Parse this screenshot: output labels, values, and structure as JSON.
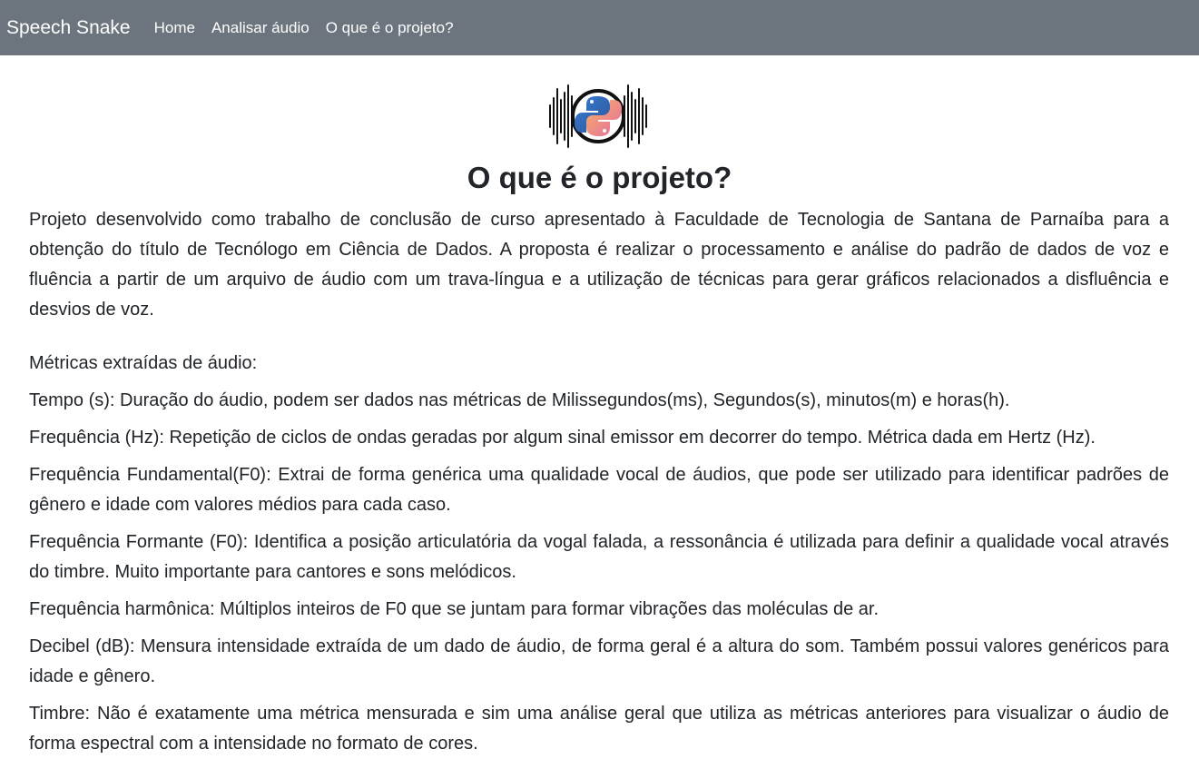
{
  "navbar": {
    "brand": "Speech Snake",
    "links": [
      "Home",
      "Analisar áudio",
      "O que é o projeto?"
    ],
    "background": "#6c757d"
  },
  "logo": {
    "icon": "python-soundwave-logo"
  },
  "main": {
    "title": "O que é o projeto?",
    "intro": "Projeto desenvolvido como trabalho de conclusão de curso apresentado à Faculdade de Tecnologia de Santana de Parnaíba para a obtenção do título de Tecnólogo em Ciência de Dados. A proposta é realizar o processamento e análise do padrão de dados de voz e fluência a partir de um arquivo de áudio com um trava-língua e a utilização de técnicas para gerar gráficos relacionados a disfluência e desvios de voz.",
    "metrics_heading": "Métricas extraídas de áudio:",
    "metrics": [
      "Tempo (s): Duração do áudio, podem ser dados nas métricas de Milissegundos(ms), Segundos(s), minutos(m) e horas(h).",
      "Frequência (Hz): Repetição de ciclos de ondas geradas por algum sinal emissor em decorrer do tempo. Métrica dada em Hertz (Hz).",
      "Frequência Fundamental(F0): Extrai de forma genérica uma qualidade vocal de áudios, que pode ser utilizado para identificar padrões de gênero e idade com valores médios para cada caso.",
      "Frequência Formante (F0): Identifica a posição articulatória da vogal falada, a ressonância é utilizada para definir a qualidade vocal através do timbre. Muito importante para cantores e sons melódicos.",
      "Frequência harmônica: Múltiplos inteiros de F0 que se juntam para formar vibrações das moléculas de ar.",
      "Decibel (dB): Mensura intensidade extraída de um dado de áudio, de forma geral é a altura do som. Também possui valores genéricos para idade e gênero.",
      "Timbre: Não é exatamente uma métrica mensurada e sim uma análise geral que utiliza as métricas anteriores para visualizar o áudio de forma espectral com a intensidade no formato de cores."
    ]
  }
}
